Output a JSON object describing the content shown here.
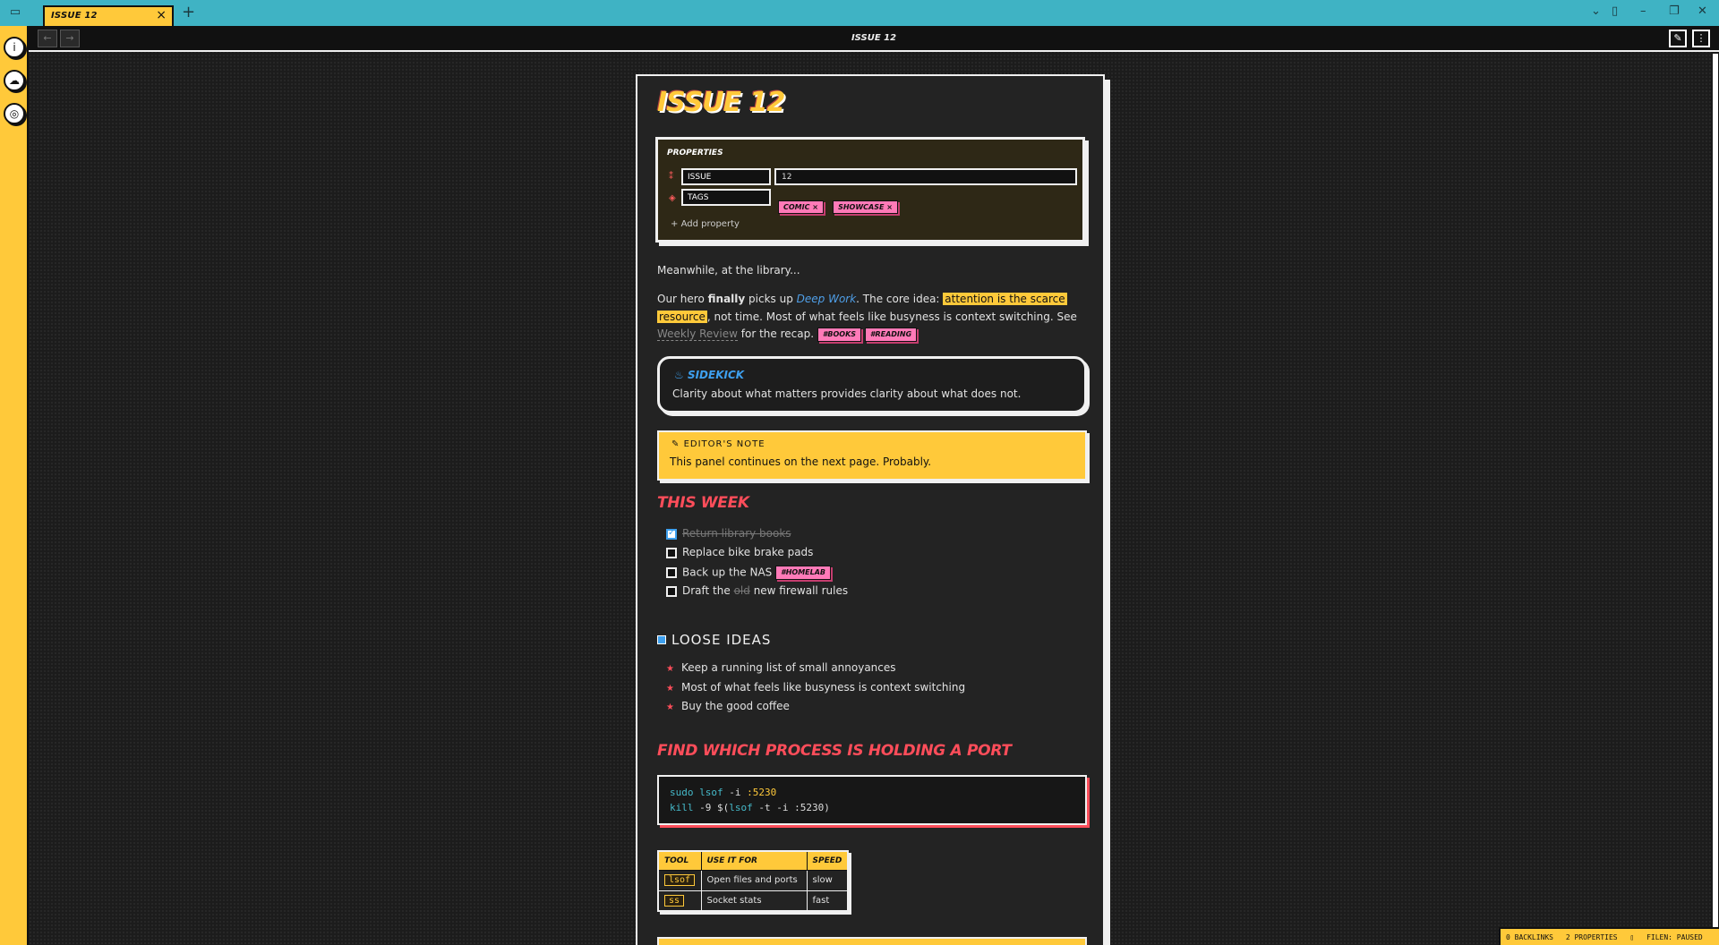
{
  "window": {
    "tab_title": "ISSUE 12",
    "new_tab": "+",
    "nav_title": "ISSUE 12"
  },
  "note": {
    "title": "ISSUE 12",
    "properties": {
      "heading": "PROPERTIES",
      "rows": [
        {
          "key": "ISSUE",
          "value": "12",
          "icon": "number-list-icon"
        },
        {
          "key": "TAGS",
          "value": "",
          "icon": "tag-icon"
        }
      ],
      "tags": [
        "COMIC",
        "SHOWCASE"
      ],
      "add_label": "Add property"
    },
    "intro": "Meanwhile, at the library...",
    "para": {
      "t1": "Our hero ",
      "bold": "finally",
      "t2": " picks up ",
      "link": "Deep Work",
      "t3": ". The core idea: ",
      "highlight1": "attention is the scarce",
      "highlight2": "resource",
      "t4": ", not time. Most of what feels like busyness is context switching. See ",
      "wikilink": "Weekly Review",
      "t5": " for the recap. ",
      "tags": [
        "#BOOKS",
        "#READING"
      ]
    },
    "sidekick": {
      "title": "SIDEKICK",
      "body": "Clarity about what matters provides clarity about what does not."
    },
    "editors_note": {
      "title": "EDITOR'S NOTE",
      "body": "This panel continues on the next page. Probably."
    },
    "this_week": {
      "heading": "THIS WEEK",
      "tasks": [
        {
          "text": "Return library books",
          "done": true
        },
        {
          "text": "Replace bike brake pads",
          "done": false
        },
        {
          "text": "Back up the NAS",
          "done": false,
          "tag": "#HOMELAB"
        },
        {
          "pre": "Draft the ",
          "strike": "old",
          "post": " new firewall rules",
          "done": false
        }
      ]
    },
    "loose_ideas": {
      "heading": "LOOSE IDEAS",
      "items": [
        "Keep a running list of small annoyances",
        "Most of what feels like busyness is context switching",
        "Buy the good coffee"
      ]
    },
    "port_section": {
      "heading": "FIND WHICH PROCESS IS HOLDING A PORT",
      "code_line1": {
        "a": "sudo",
        "b": "lsof",
        "c": " -i ",
        "d": ":5230"
      },
      "code_line2": {
        "a": "kill",
        "b": " -9 $(",
        "c": "lsof",
        "d": " -t -i :5230)"
      }
    },
    "table": {
      "headers": [
        "TOOL",
        "USE IT FOR",
        "SPEED"
      ],
      "rows": [
        [
          "lsof",
          "Open files and ports",
          "slow"
        ],
        [
          "ss",
          "Socket stats",
          "fast"
        ]
      ]
    }
  },
  "statusbar": {
    "backlinks": "0 BACKLINKS",
    "properties": "2 PROPERTIES",
    "filen": "FILEN: PAUSED"
  },
  "colors": {
    "accent_yellow": "#ffc93a",
    "titlebar_teal": "#3fb3c4",
    "heading_red": "#ff4d5a",
    "tag_pink": "#ff7ab8",
    "link_blue": "#3ea0ef"
  }
}
